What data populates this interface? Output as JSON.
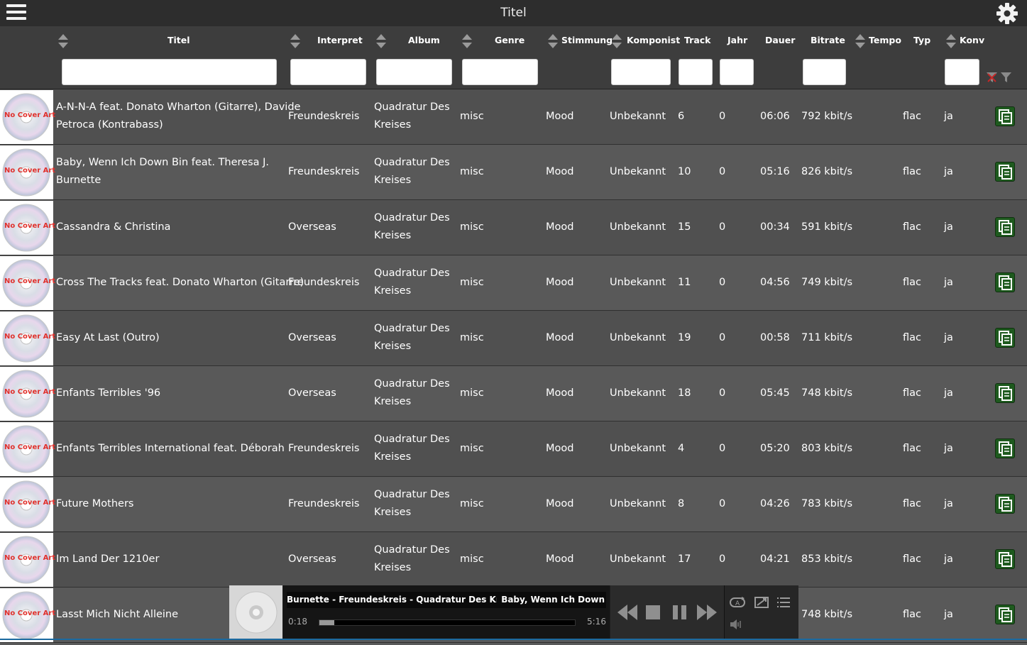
{
  "topbar": {
    "title": "Titel"
  },
  "columns": {
    "titel": "Titel",
    "interpret": "Interpret",
    "album": "Album",
    "genre": "Genre",
    "stimmung": "Stimmung",
    "komponist": "Komponist",
    "track": "Track",
    "jahr": "Jahr",
    "dauer": "Dauer",
    "bitrate": "Bitrate",
    "tempo": "Tempo",
    "typ": "Typ",
    "konv": "Konv"
  },
  "filters": {
    "titel": "",
    "interpret": "",
    "album": "",
    "genre": "",
    "komponist": "",
    "track": "",
    "jahr": "",
    "bitrate": "",
    "konv": ""
  },
  "cover_label": "No Cover Art",
  "rows": [
    {
      "title_line1": "A-N-N-A feat. Donato Wharton (Gitarre), Davide",
      "title_line2": "Petroca (Kontrabass)",
      "interpret": "Freundeskreis",
      "album_line1": "Quadratur Des",
      "album_line2": "Kreises",
      "genre": "misc",
      "stimmung": "Mood",
      "komponist": "Unbekannt",
      "track": "6",
      "jahr": "0",
      "dauer": "06:06",
      "bitrate": "792 kbit/s",
      "typ": "flac",
      "konv": "ja"
    },
    {
      "title_line1": "Baby, Wenn Ich Down Bin feat. Theresa J.",
      "title_line2": "Burnette",
      "interpret": "Freundeskreis",
      "album_line1": "Quadratur Des",
      "album_line2": "Kreises",
      "genre": "misc",
      "stimmung": "Mood",
      "komponist": "Unbekannt",
      "track": "10",
      "jahr": "0",
      "dauer": "05:16",
      "bitrate": "826 kbit/s",
      "typ": "flac",
      "konv": "ja"
    },
    {
      "title_line1": "Cassandra & Christina",
      "title_line2": "",
      "interpret": "Overseas",
      "album_line1": "Quadratur Des",
      "album_line2": "Kreises",
      "genre": "misc",
      "stimmung": "Mood",
      "komponist": "Unbekannt",
      "track": "15",
      "jahr": "0",
      "dauer": "00:34",
      "bitrate": "591 kbit/s",
      "typ": "flac",
      "konv": "ja"
    },
    {
      "title_line1": "Cross The Tracks feat. Donato Wharton (Gitarre)",
      "title_line2": "",
      "interpret": "Freundeskreis",
      "album_line1": "Quadratur Des",
      "album_line2": "Kreises",
      "genre": "misc",
      "stimmung": "Mood",
      "komponist": "Unbekannt",
      "track": "11",
      "jahr": "0",
      "dauer": "04:56",
      "bitrate": "749 kbit/s",
      "typ": "flac",
      "konv": "ja"
    },
    {
      "title_line1": "Easy At Last (Outro)",
      "title_line2": "",
      "interpret": "Overseas",
      "album_line1": "Quadratur Des",
      "album_line2": "Kreises",
      "genre": "misc",
      "stimmung": "Mood",
      "komponist": "Unbekannt",
      "track": "19",
      "jahr": "0",
      "dauer": "00:58",
      "bitrate": "711 kbit/s",
      "typ": "flac",
      "konv": "ja"
    },
    {
      "title_line1": "Enfants Terribles '96",
      "title_line2": "",
      "interpret": "Overseas",
      "album_line1": "Quadratur Des",
      "album_line2": "Kreises",
      "genre": "misc",
      "stimmung": "Mood",
      "komponist": "Unbekannt",
      "track": "18",
      "jahr": "0",
      "dauer": "05:45",
      "bitrate": "748 kbit/s",
      "typ": "flac",
      "konv": "ja"
    },
    {
      "title_line1": "Enfants Terribles International feat. Déborah",
      "title_line2": "",
      "interpret": "Freundeskreis",
      "album_line1": "Quadratur Des",
      "album_line2": "Kreises",
      "genre": "misc",
      "stimmung": "Mood",
      "komponist": "Unbekannt",
      "track": "4",
      "jahr": "0",
      "dauer": "05:20",
      "bitrate": "803 kbit/s",
      "typ": "flac",
      "konv": "ja"
    },
    {
      "title_line1": "Future Mothers",
      "title_line2": "",
      "interpret": "Freundeskreis",
      "album_line1": "Quadratur Des",
      "album_line2": "Kreises",
      "genre": "misc",
      "stimmung": "Mood",
      "komponist": "Unbekannt",
      "track": "8",
      "jahr": "0",
      "dauer": "04:26",
      "bitrate": "783 kbit/s",
      "typ": "flac",
      "konv": "ja"
    },
    {
      "title_line1": "Im Land Der 1210er",
      "title_line2": "",
      "interpret": "Overseas",
      "album_line1": "Quadratur Des",
      "album_line2": "Kreises",
      "genre": "misc",
      "stimmung": "Mood",
      "komponist": "Unbekannt",
      "track": "17",
      "jahr": "0",
      "dauer": "04:21",
      "bitrate": "853 kbit/s",
      "typ": "flac",
      "konv": "ja"
    },
    {
      "title_line1": "Lasst Mich Nicht Alleine",
      "title_line2": "",
      "interpret": "",
      "album_line1": "",
      "album_line2": "",
      "genre": "",
      "stimmung": "",
      "komponist": "",
      "track": "",
      "jahr": "",
      "dauer": "",
      "bitrate": "748 kbit/s",
      "typ": "flac",
      "konv": "ja"
    }
  ],
  "player": {
    "marquee_left": "Burnette - Freundeskreis - Quadratur Des Kreises",
    "marquee_right": "Baby, Wenn Ich Down",
    "elapsed": "0:18",
    "total": "5:16",
    "progress_fraction": 0.057
  },
  "colors": {
    "accent_green": "#1e5a1e",
    "header_bg": "#3d3d3d",
    "topbar_bg": "#2d2d2d",
    "progress_line": "#1b6aa0"
  }
}
